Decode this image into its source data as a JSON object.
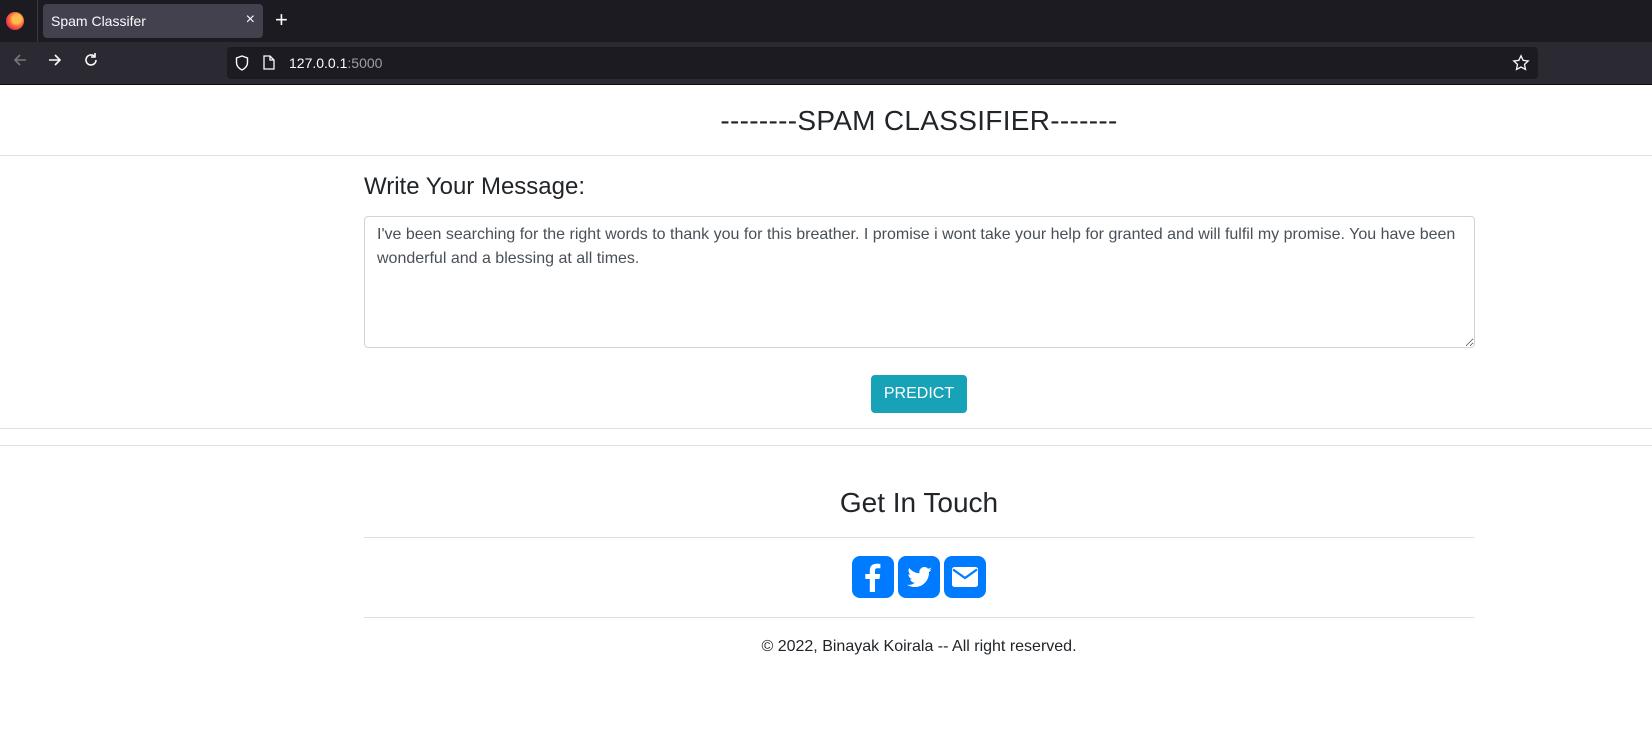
{
  "browser": {
    "tab_title": "Spam Classifer",
    "tab_close": "×",
    "new_tab": "+",
    "url_host": "127.0.0.1",
    "url_port": ":5000"
  },
  "page": {
    "header_title": "--------SPAM CLASSIFIER-------",
    "message_label": "Write Your Message:",
    "message_value": "I've been searching for the right words to thank you for this breather. I promise i wont take your help for granted and will fulfil my promise. You have been wonderful and a blessing at all times.",
    "predict_label": "PREDICT",
    "contact_title": "Get In Touch",
    "social_icons": [
      "facebook-icon",
      "twitter-icon",
      "envelope-icon"
    ],
    "copyright": "© 2022, Binayak Koirala -- All right reserved."
  },
  "colors": {
    "accent": "#17a2b8",
    "social": "#007bff"
  }
}
